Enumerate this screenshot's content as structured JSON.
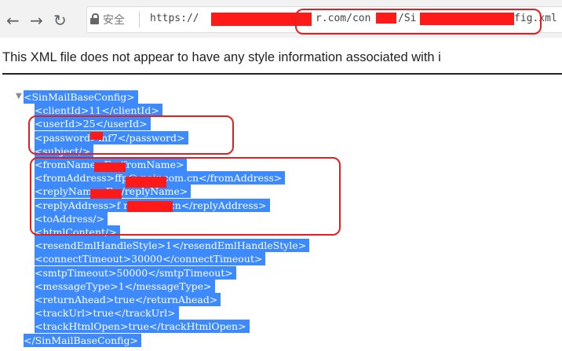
{
  "browser": {
    "security_label": "安全",
    "url_scheme": "https://",
    "url_mid": "r.com/con",
    "url_path": "/Si",
    "url_end": "fig.xml"
  },
  "page": {
    "notice": "This XML file does not appear to have any style information associated with i"
  },
  "xml": {
    "lines": [
      "<SinMailBaseConfig>",
      "<clientId>11</clientId>",
      "<userId>25</userId>",
      "<password>mf7</password>",
      "<subject/>",
      "<fromName>E</fromName>",
      "<fromAddress>ffp@ nair.com.cn</fromAddress>",
      "<replyName>E</replyName>",
      "<replyAddress>f nair.com.cn</replyAddress>",
      "<toAddress/>",
      "<htmlContent/>",
      "<resendEmlHandleStyle>1</resendEmlHandleStyle>",
      "<connectTimeout>30000</connectTimeout>",
      "<smtpTimeout>50000</smtpTimeout>",
      "<messageType>1</messageType>",
      "<returnAhead>true</returnAhead>",
      "<trackUrl>true</trackUrl>",
      "<trackHtmlOpen>true</trackHtmlOpen>",
      "</SinMailBaseConfig>"
    ]
  },
  "colors": {
    "selection": "#3d8aff",
    "redaction": "#ff1a1a",
    "annotation": "#e02020"
  }
}
